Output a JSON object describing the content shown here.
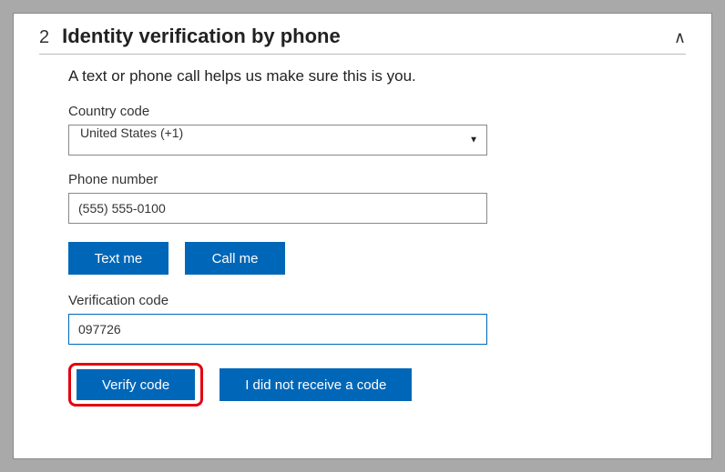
{
  "step_number": "2",
  "title": "Identity verification by phone",
  "description": "A text or phone call helps us make sure this is you.",
  "country_code": {
    "label": "Country code",
    "selected": "United States (+1)"
  },
  "phone_number": {
    "label": "Phone number",
    "value": "(555) 555-0100"
  },
  "buttons": {
    "text_me": "Text me",
    "call_me": "Call me",
    "verify_code": "Verify code",
    "no_code": "I did not receive a code"
  },
  "verification_code": {
    "label": "Verification code",
    "value": "097726"
  }
}
